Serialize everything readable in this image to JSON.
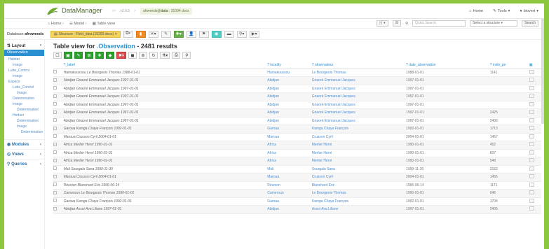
{
  "app": {
    "title": "DataManager"
  },
  "crumbs": {
    "version": "v2.6.5",
    "db": "afrweeds",
    "schema": "data",
    "docs": "31094 docs"
  },
  "top_right": {
    "home": "Home",
    "tools": "Tools",
    "user": "biovert"
  },
  "nav": {
    "home": "Home",
    "model": "Model",
    "table_view": "Table view"
  },
  "search": {
    "placeholder": "Quick Search",
    "structure": "Select a structure",
    "button": "Search"
  },
  "database": {
    "label": "Database",
    "name": "afroweeds"
  },
  "structure_pill": "Structure : Field_data (16293 docs)",
  "sidebar": {
    "layout": "Layout",
    "selected": "Observation",
    "items": [
      "Habitat",
      "Image",
      "Lutte_Control",
      "Image",
      "Espece",
      "Lutte_Control",
      "Image",
      "Determination",
      "Image",
      "Determination",
      "Herbier",
      "Determination",
      "Image",
      "Determination"
    ],
    "modules": "Modules",
    "views": "Views",
    "queries": "Queries"
  },
  "main": {
    "title_prefix": "Table view for ",
    "title_obj": ".Observation",
    "title_suffix": " - 2481 results"
  },
  "table": {
    "headers": [
      "?_label",
      "? locality",
      "? observateur",
      "? date_observation",
      "? indiv_pn"
    ],
    "rows": [
      [
        "Hamakoussou Le Bourgeois Thomas 1988-01-01",
        "Hamakoussou",
        "Le Bourgeois Thomas",
        "1988-01-01",
        "1141"
      ],
      [
        "Abidjan Gnaoré Emmanuel Jacques 1997-01-01",
        "Abidjan",
        "Gnaoré Emmanuel Jacques",
        "1997-01-01",
        ""
      ],
      [
        "Abidjan Gnaoré Emmanuel Jacques 1997-01-01",
        "Abidjan",
        "Gnaoré Emmanuel Jacques",
        "1997-01-01",
        ""
      ],
      [
        "Abidjan Gnaoré Emmanuel Jacques 1997-01-01",
        "Abidjan",
        "Gnaoré Emmanuel Jacques",
        "1997-01-01",
        ""
      ],
      [
        "Abidjan Gnaoré Emmanuel Jacques 1997-01-01",
        "Abidjan",
        "Gnaoré Emmanuel Jacques",
        "1997-01-01",
        ""
      ],
      [
        "Abidjan Gnaoré Emmanuel Jacques 1997-01-01",
        "Abidjan",
        "Gnaoré Emmanuel Jacques",
        "1997-01-01",
        "2425"
      ],
      [
        "Abidjan Gnaoré Emmanuel Jacques 1997-01-01",
        "Abidjan",
        "Gnaoré Emmanuel Jacques",
        "1997-01-01",
        "2406"
      ],
      [
        "Garoua Kamga Chaye François 1992-01-01",
        "Garoua",
        "Kamga Chaye François",
        "1992-01-01",
        "1713"
      ],
      [
        "Maroua Crusson Cyril 2004-01-01",
        "Maroua",
        "Crusson Cyril",
        "2004-01-01",
        "1457"
      ],
      [
        "Africa Merlier Henri 1990-01-01",
        "Africa",
        "Merlier Henri",
        "1990-01-01",
        "452"
      ],
      [
        "Africa Merlier Henri 1990-01-01",
        "Africa",
        "Merlier Henri",
        "1990-01-01",
        "607"
      ],
      [
        "Africa Merlier Henri 1990-01-01",
        "Africa",
        "Merlier Henri",
        "1990-01-01",
        "548"
      ],
      [
        "Mali Sourgalo Sana 1999-11-30",
        "Mali",
        "Sourgalo Sana",
        "1999-11-30",
        "2152"
      ],
      [
        "Maroua Crusson Cyril 2004-01-01",
        "Maroua",
        "Crusson Cyril",
        "2004-01-01",
        "1455"
      ],
      [
        "Réunion Blanchard Eric 1996-06-14",
        "Réunion",
        "Blanchard Eric",
        "1996-06-14",
        "1171"
      ],
      [
        "Cameroun Le Bourgeois Thomas 1990-01-01",
        "Cameroun",
        "Le Bourgeois Thomas",
        "1990-01-01",
        "646"
      ],
      [
        "Garoua Kamga Chaye François 1992-01-01",
        "Garoua",
        "Kamga Chaye François",
        "1992-01-01",
        "1704"
      ],
      [
        "Abidjan Assoi Ava Liliane 1997-01-01",
        "Abidjan",
        "Assoi Ava Liliane",
        "1997-01-01",
        "2405"
      ]
    ]
  },
  "colors": {
    "accent": "#2a8fd0",
    "brand": "#8dc63f",
    "pill": "#f4d35e"
  }
}
